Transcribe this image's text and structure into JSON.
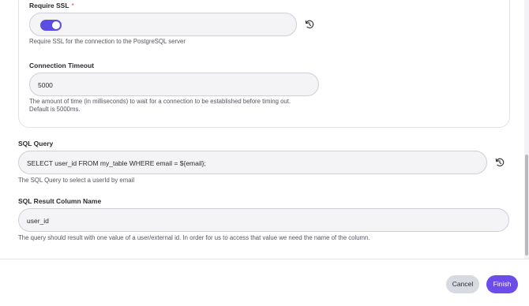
{
  "ssl": {
    "label": "Require SSL",
    "required_mark": "*",
    "enabled": true,
    "help": "Require SSL for the connection to the PostgreSQL server"
  },
  "timeout": {
    "label": "Connection Timeout",
    "value": "5000",
    "help_line1": "The amount of time (in milliseconds) to wait for a connection to be established before timing out.",
    "help_line2": "Default is 5000ms."
  },
  "sql_query": {
    "label": "SQL Query",
    "value": "SELECT user_id FROM my_table  WHERE email = ${email};",
    "help": "The SQL Query to select a userId by email"
  },
  "result_column": {
    "label": "SQL Result Column Name",
    "value": "user_id",
    "help": "The query should result with one value of a user/external id. In order for us to access that value we need the name of the column."
  },
  "footer": {
    "cancel_label": "Cancel",
    "finish_label": "Finish"
  },
  "icons": {
    "reset": "reset-icon"
  }
}
